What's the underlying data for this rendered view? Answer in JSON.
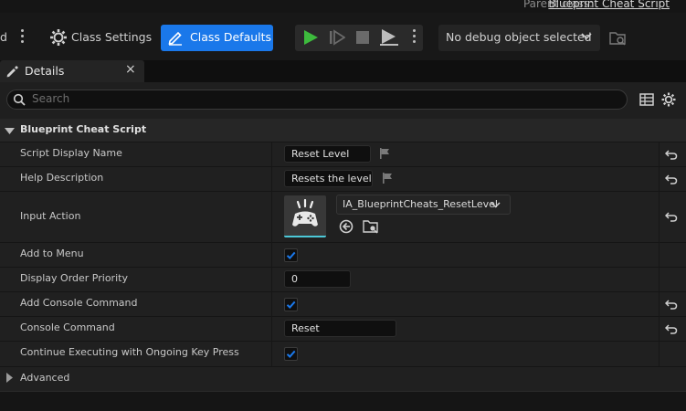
{
  "header": {
    "parent_class_label": "Parent class:",
    "parent_class_value": "Blueprint Cheat Script"
  },
  "toolbar": {
    "partial_label": "d",
    "class_settings_label": "Class Settings",
    "class_defaults_label": "Class Defaults",
    "debug_selector_value": "No debug object selected"
  },
  "tab": {
    "label": "Details",
    "close": "×"
  },
  "search": {
    "placeholder": "Search"
  },
  "details": {
    "section_title": "Blueprint Cheat Script",
    "rows": [
      {
        "label": "Script Display Name",
        "value": "Reset Level"
      },
      {
        "label": "Help Description",
        "value": "Resets the level"
      },
      {
        "label": "Input Action",
        "value": "IA_BlueprintCheats_ResetLevel"
      },
      {
        "label": "Add to Menu",
        "checked": true
      },
      {
        "label": "Display Order Priority",
        "value": "0"
      },
      {
        "label": "Add Console Command",
        "checked": true
      },
      {
        "label": "Console Command",
        "value": "Reset"
      },
      {
        "label": "Continue Executing with Ongoing Key Press",
        "checked": true
      }
    ],
    "advanced_label": "Advanced"
  },
  "colors": {
    "accent": "#1a78ea",
    "play_green": "#3dbb3d",
    "background": "#202020"
  }
}
